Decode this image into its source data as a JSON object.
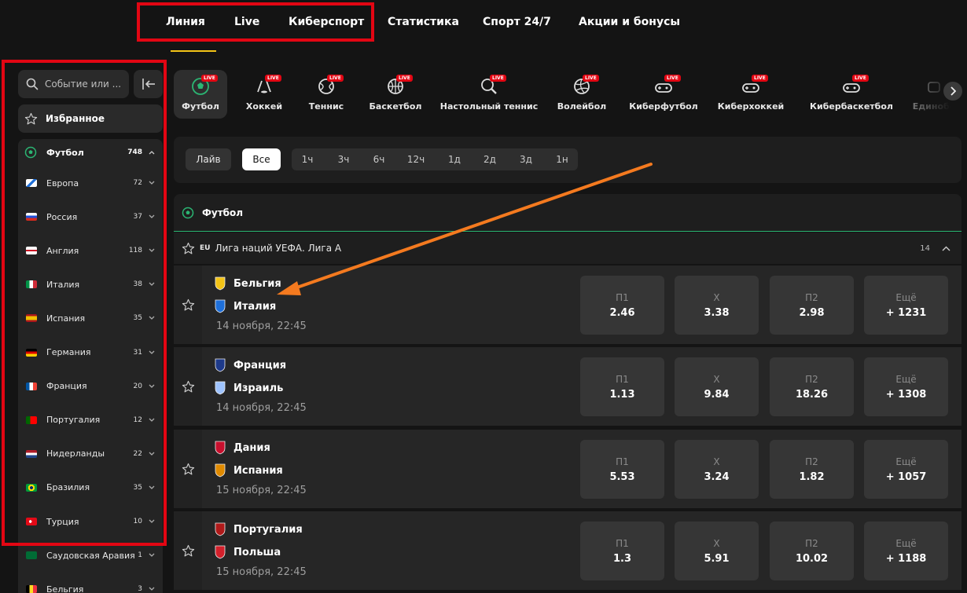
{
  "nav": {
    "items": [
      "Линия",
      "Live",
      "Киберспорт",
      "Статистика",
      "Спорт 24/7",
      "Акции и бонусы"
    ]
  },
  "sidebar": {
    "search_placeholder": "Событие или ...",
    "favorites_label": "Избранное",
    "sport": {
      "label": "Футбол",
      "count": "748"
    },
    "countries": [
      {
        "label": "Европа",
        "count": "72"
      },
      {
        "label": "Россия",
        "count": "37"
      },
      {
        "label": "Англия",
        "count": "118"
      },
      {
        "label": "Италия",
        "count": "38"
      },
      {
        "label": "Испания",
        "count": "35"
      },
      {
        "label": "Германия",
        "count": "31"
      },
      {
        "label": "Франция",
        "count": "20"
      },
      {
        "label": "Португалия",
        "count": "12"
      },
      {
        "label": "Нидерланды",
        "count": "22"
      },
      {
        "label": "Бразилия",
        "count": "35"
      },
      {
        "label": "Турция",
        "count": "10"
      },
      {
        "label": "Саудовская Аравия",
        "count": "1"
      },
      {
        "label": "Бельгия",
        "count": "3"
      }
    ]
  },
  "sports_tabs": {
    "live_badge": "LIVE",
    "items": [
      "Футбол",
      "Хоккей",
      "Теннис",
      "Баскетбол",
      "Настольный теннис",
      "Волейбол",
      "Киберфутбол",
      "Киберхоккей",
      "Кибербаскетбол",
      "Единобо"
    ]
  },
  "filters": {
    "live": "Лайв",
    "all": "Все",
    "times": [
      "1ч",
      "3ч",
      "6ч",
      "12ч",
      "1д",
      "2д",
      "3д",
      "1н"
    ]
  },
  "events": {
    "sport_title": "Футбол",
    "league": {
      "prefix": "EU",
      "name": "Лига наций УЕФА. Лига А",
      "count": "14"
    },
    "odds_headers": {
      "p1": "П1",
      "x": "Х",
      "p2": "П2",
      "more": "Ещё"
    },
    "matches": [
      {
        "home": "Бельгия",
        "away": "Италия",
        "time": "14 ноября, 22:45",
        "p1": "2.46",
        "x": "3.38",
        "p2": "2.98",
        "more": "+ 1231"
      },
      {
        "home": "Франция",
        "away": "Израиль",
        "time": "14 ноября, 22:45",
        "p1": "1.13",
        "x": "9.84",
        "p2": "18.26",
        "more": "+ 1308"
      },
      {
        "home": "Дания",
        "away": "Испания",
        "time": "15 ноября, 22:45",
        "p1": "5.53",
        "x": "3.24",
        "p2": "1.82",
        "more": "+ 1057"
      },
      {
        "home": "Португалия",
        "away": "Польша",
        "time": "15 ноября, 22:45",
        "p1": "1.3",
        "x": "5.91",
        "p2": "10.02",
        "more": "+ 1188"
      }
    ]
  },
  "colors": {
    "accent_green": "#2bb673",
    "live_red": "#e30613",
    "annotation_red": "#e30613",
    "annotation_arrow": "#f47a1f"
  }
}
